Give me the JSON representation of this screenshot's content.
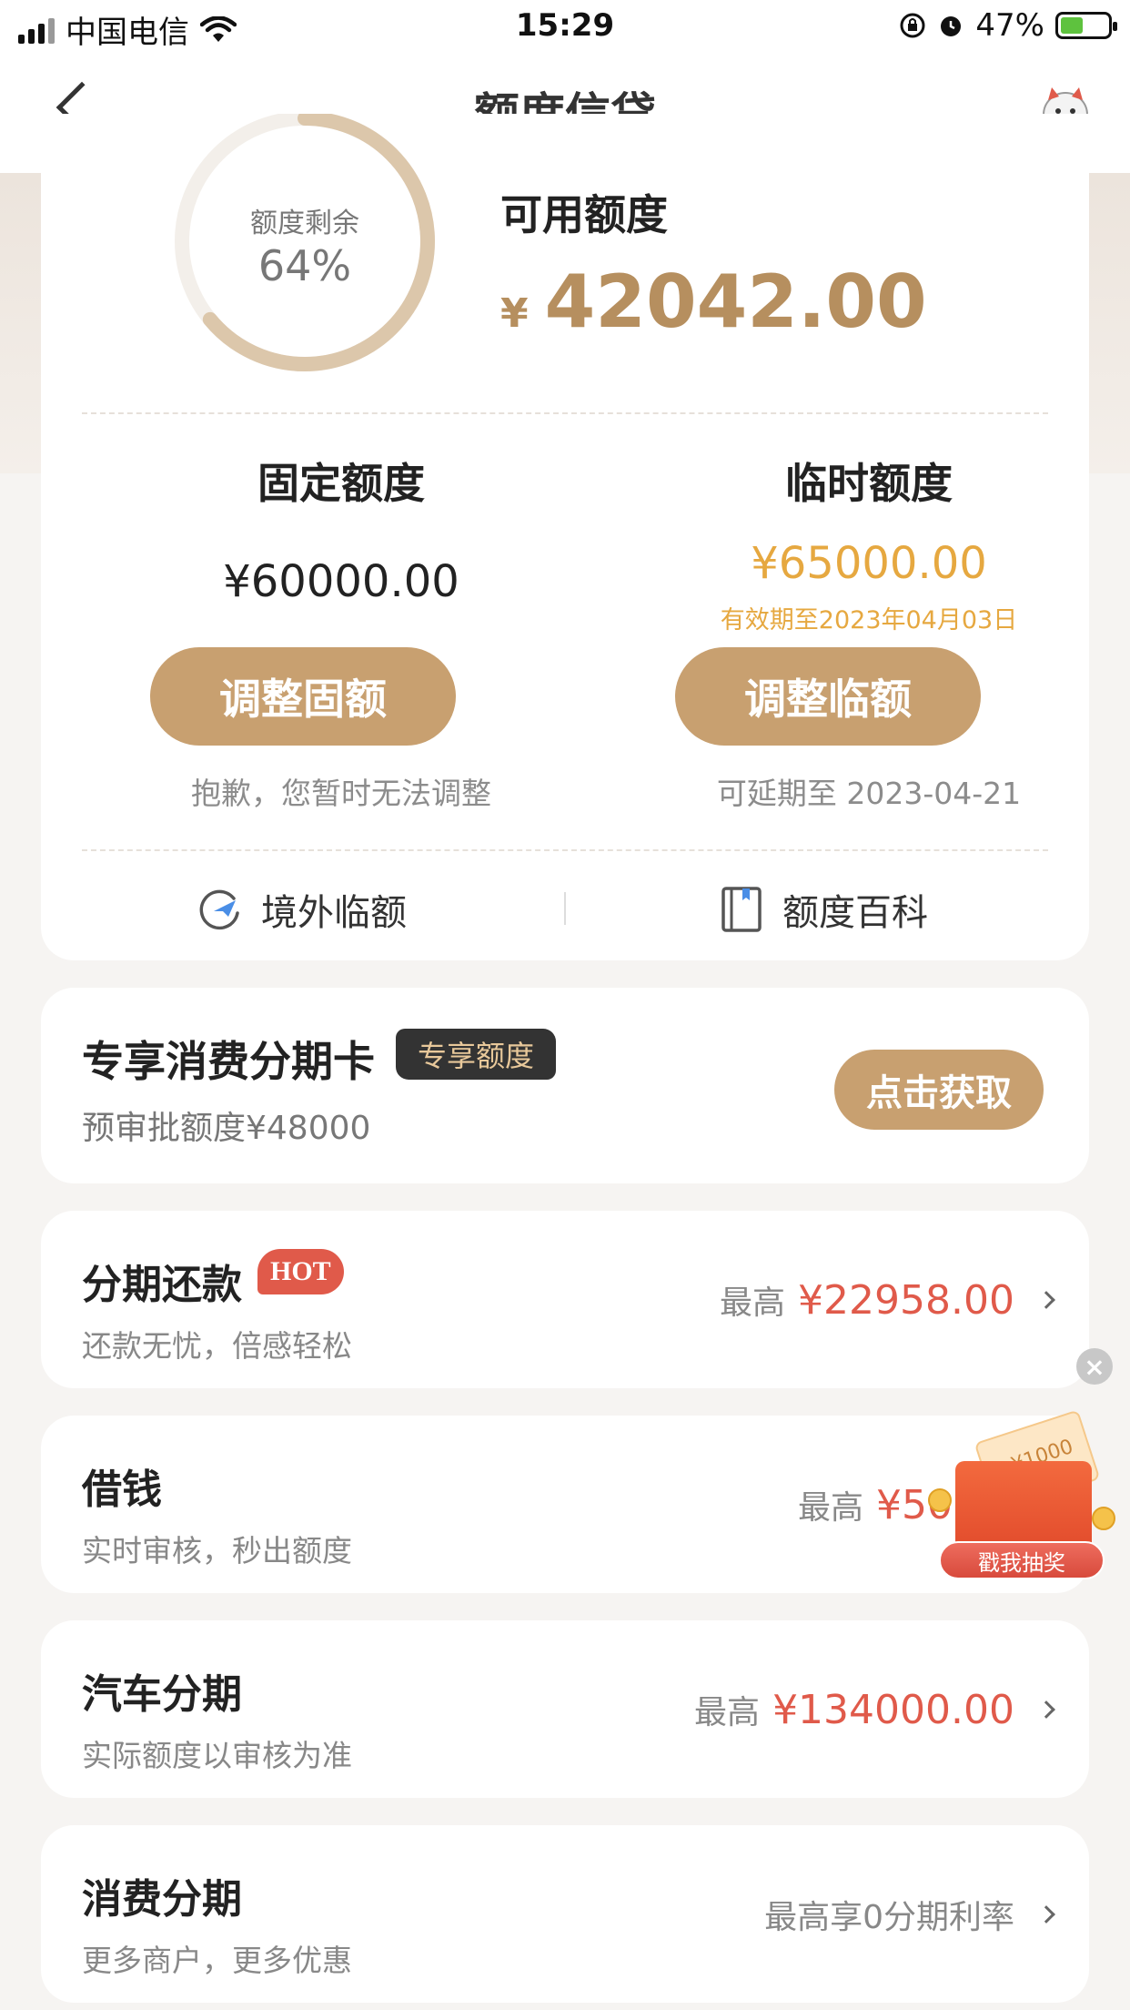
{
  "status_bar": {
    "carrier": "中国电信",
    "time": "15:29",
    "battery": "47%",
    "battery_level": 0.47
  },
  "nav": {
    "title": "额度信贷"
  },
  "credit": {
    "ring_label": "额度剩余",
    "ring_value": "64%",
    "ring_fraction": 0.64,
    "available_label": "可用额度",
    "currency": "¥",
    "available_value": "42042.00",
    "fixed": {
      "label": "固定额度",
      "value": "¥60000.00",
      "button": "调整固额",
      "note": "抱歉，您暂时无法调整"
    },
    "temp": {
      "label": "临时额度",
      "value": "¥65000.00",
      "expiry": "有效期至2023年04月03日",
      "button": "调整临额",
      "note": "可延期至 2023-04-21"
    },
    "links": {
      "overseas": "境外临额",
      "wiki": "额度百科"
    }
  },
  "exclusive": {
    "title": "专享消费分期卡",
    "tag": "专享额度",
    "subtitle": "预审批额度¥48000",
    "button": "点击获取"
  },
  "items": [
    {
      "title": "分期还款",
      "badge": "HOT",
      "subtitle": "还款无忧，倍感轻松",
      "prefix": "最高",
      "amount": "¥22958.00"
    },
    {
      "title": "借钱",
      "subtitle": "实时审核，秒出额度",
      "prefix": "最高",
      "amount": "¥50"
    },
    {
      "title": "汽车分期",
      "subtitle": "实际额度以审核为准",
      "prefix": "最高",
      "amount": "¥134000.00"
    },
    {
      "title": "消费分期",
      "subtitle": "更多商户，更多优惠",
      "prefix": "最高享0分期利率",
      "amount": ""
    }
  ],
  "lottery": {
    "button": "戳我抽奖",
    "ticket_text": "¥1000"
  },
  "colors": {
    "gold": "#c8a070",
    "gold_text": "#b68f5f",
    "orange": "#e6a840",
    "red": "#e05a4a"
  }
}
